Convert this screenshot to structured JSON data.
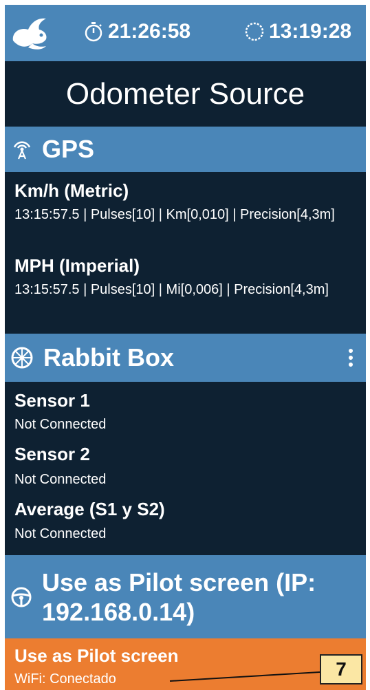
{
  "topbar": {
    "timer1": "21:26:58",
    "timer2": "13:19:28",
    "logo_icon": "rabbit-logo",
    "timer1_icon": "stopwatch-icon",
    "timer2_icon": "clock-dotted-icon"
  },
  "title": "Odometer Source",
  "gps": {
    "title": "GPS",
    "icon": "antenna-icon",
    "items": [
      {
        "title": "Km/h (Metric)",
        "desc": "13:15:57.5 | Pulses[10] | Km[0,010] | Precision[4,3m]"
      },
      {
        "title": "MPH (Imperial)",
        "desc": "13:15:57.5 | Pulses[10] | Mi[0,006] | Precision[4,3m]"
      }
    ]
  },
  "rabbit_box": {
    "title": "Rabbit Box",
    "icon": "wheel-icon",
    "menu_icon": "more-vertical-icon",
    "items": [
      {
        "title": "Sensor 1",
        "desc": "Not Connected"
      },
      {
        "title": "Sensor 2",
        "desc": "Not Connected"
      },
      {
        "title": "Average (S1 y S2)",
        "desc": "Not Connected"
      }
    ]
  },
  "pilot": {
    "title_line1": "Use as Pilot screen (IP:",
    "title_line2": "192.168.0.14)",
    "icon": "steering-wheel-icon",
    "item_title": "Use as Pilot screen",
    "item_desc": "WiFi: Conectado"
  },
  "callout": {
    "label": "7"
  },
  "colors": {
    "header_blue": "#4a86b8",
    "background_navy": "#0e2132",
    "highlight_orange": "#ec7d30",
    "callout_fill": "#fbe7a4"
  }
}
